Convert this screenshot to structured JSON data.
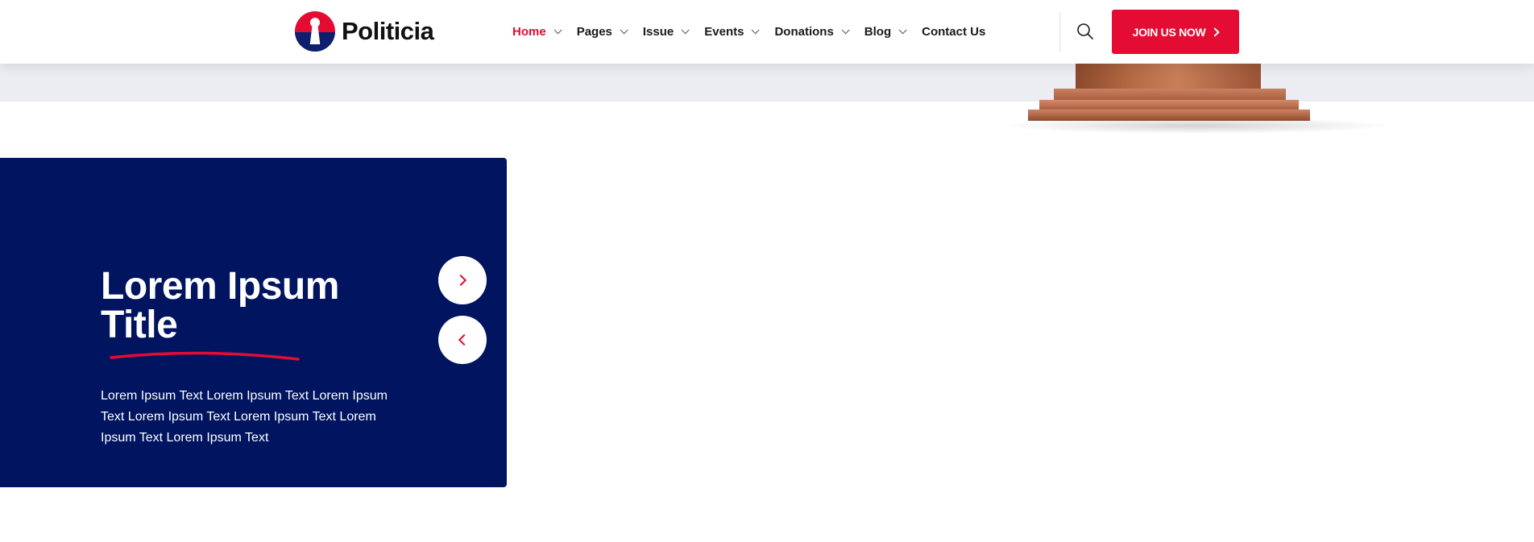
{
  "brand": {
    "name": "Politicia",
    "accent": "#e40c33",
    "navy": "#001460"
  },
  "nav": {
    "items": [
      {
        "label": "Home",
        "active": true,
        "dropdown": true
      },
      {
        "label": "Pages",
        "active": false,
        "dropdown": true
      },
      {
        "label": "Issue",
        "active": false,
        "dropdown": true
      },
      {
        "label": "Events",
        "active": false,
        "dropdown": true
      },
      {
        "label": "Donations",
        "active": false,
        "dropdown": true
      },
      {
        "label": "Blog",
        "active": false,
        "dropdown": true
      },
      {
        "label": "Contact Us",
        "active": false,
        "dropdown": false
      }
    ]
  },
  "header": {
    "cta_label": "JOIN US NOW",
    "search_icon": "search-icon"
  },
  "card": {
    "title": "Lorem Ipsum Title",
    "text": "Lorem Ipsum Text Lorem Ipsum Text Lorem Ipsum Text Lorem Ipsum Text Lorem Ipsum Text Lorem Ipsum Text Lorem Ipsum Text",
    "next_icon": "chevron-right-icon",
    "prev_icon": "chevron-left-icon"
  }
}
